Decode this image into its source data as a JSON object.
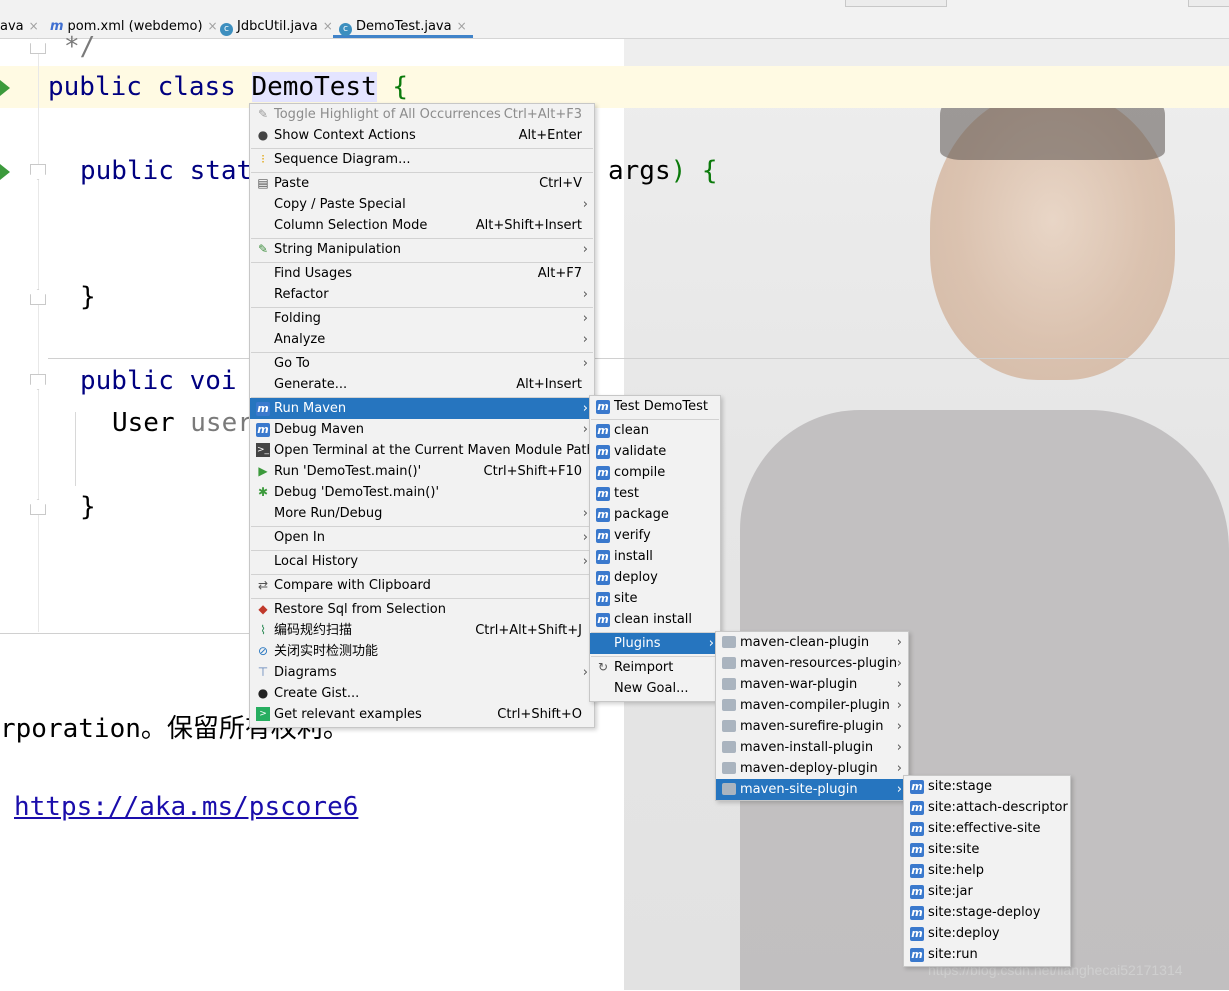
{
  "tabs": [
    {
      "name": "tab-java-partial",
      "icon": "java-file-icon",
      "label": "ava",
      "close": "×"
    },
    {
      "name": "tab-pom",
      "icon": "maven-icon",
      "label": "pom.xml (webdemo)",
      "close": "×"
    },
    {
      "name": "tab-jdbcutil",
      "icon": "class-icon",
      "label": "JdbcUtil.java",
      "close": "×"
    },
    {
      "name": "tab-demotest",
      "icon": "class-icon",
      "label": "DemoTest.java",
      "close": "×",
      "active": true
    }
  ],
  "code": {
    "comment_end": "*/",
    "line1_kw": "public class ",
    "line1_class": "DemoTest",
    "line1_brace": " {",
    "line2_kw": "public stat",
    "line2_rest": "args",
    "line2_brace": ") {",
    "line3_brace": "}",
    "line4_kw": "public voi",
    "line5_type": "User ",
    "line5_var": "user",
    "line6_brace": "}"
  },
  "console": {
    "line1": "rporation。保留所有权利。",
    "link": "https://aka.ms/pscore6"
  },
  "watermark": "https://blog.csdn.net/lianghecai52171314",
  "context_menu": {
    "items": [
      {
        "label": "Toggle Highlight of All Occurrences",
        "shortcut": "Ctrl+Alt+F3",
        "disabled": true
      },
      {
        "label": "Show Context Actions",
        "shortcut": "Alt+Enter"
      },
      {
        "label": "Sequence Diagram..."
      },
      {
        "label": "Paste",
        "shortcut": "Ctrl+V"
      },
      {
        "label": "Copy / Paste Special"
      },
      {
        "label": "Column Selection Mode",
        "shortcut": "Alt+Shift+Insert"
      },
      {
        "label": "String Manipulation"
      },
      {
        "label": "Find Usages",
        "shortcut": "Alt+F7"
      },
      {
        "label": "Refactor"
      },
      {
        "label": "Folding"
      },
      {
        "label": "Analyze"
      },
      {
        "label": "Go To"
      },
      {
        "label": "Generate...",
        "shortcut": "Alt+Insert"
      },
      {
        "label": "Run Maven"
      },
      {
        "label": "Debug Maven"
      },
      {
        "label": "Open Terminal at the Current Maven Module Path"
      },
      {
        "label": "Run 'DemoTest.main()'",
        "shortcut": "Ctrl+Shift+F10"
      },
      {
        "label": "Debug 'DemoTest.main()'"
      },
      {
        "label": "More Run/Debug"
      },
      {
        "label": "Open In"
      },
      {
        "label": "Local History"
      },
      {
        "label": "Compare with Clipboard"
      },
      {
        "label": "Restore Sql from Selection"
      },
      {
        "label": "编码规约扫描",
        "shortcut": "Ctrl+Alt+Shift+J"
      },
      {
        "label": "关闭实时检测功能"
      },
      {
        "label": "Diagrams"
      },
      {
        "label": "Create Gist..."
      },
      {
        "label": "Get relevant examples",
        "shortcut": "Ctrl+Shift+O"
      }
    ]
  },
  "run_maven_menu": {
    "items": [
      {
        "label": "Test DemoTest"
      },
      {
        "label": "clean"
      },
      {
        "label": "validate"
      },
      {
        "label": "compile"
      },
      {
        "label": "test"
      },
      {
        "label": "package"
      },
      {
        "label": "verify"
      },
      {
        "label": "install"
      },
      {
        "label": "deploy"
      },
      {
        "label": "site"
      },
      {
        "label": "clean install"
      },
      {
        "label": "Plugins"
      },
      {
        "label": "Reimport"
      },
      {
        "label": "New Goal..."
      }
    ]
  },
  "plugins_menu": {
    "items": [
      {
        "label": "maven-clean-plugin"
      },
      {
        "label": "maven-resources-plugin"
      },
      {
        "label": "maven-war-plugin"
      },
      {
        "label": "maven-compiler-plugin"
      },
      {
        "label": "maven-surefire-plugin"
      },
      {
        "label": "maven-install-plugin"
      },
      {
        "label": "maven-deploy-plugin"
      },
      {
        "label": "maven-site-plugin"
      }
    ]
  },
  "site_plugin_menu": {
    "items": [
      {
        "label": "site:stage"
      },
      {
        "label": "site:attach-descriptor"
      },
      {
        "label": "site:effective-site"
      },
      {
        "label": "site:site"
      },
      {
        "label": "site:help"
      },
      {
        "label": "site:jar"
      },
      {
        "label": "site:stage-deploy"
      },
      {
        "label": "site:deploy"
      },
      {
        "label": "site:run"
      }
    ]
  },
  "colors": {
    "selection": "#2675bf",
    "menu_bg": "#f2f2f2",
    "keyword": "#000080",
    "brace": "#0b7a0b"
  }
}
